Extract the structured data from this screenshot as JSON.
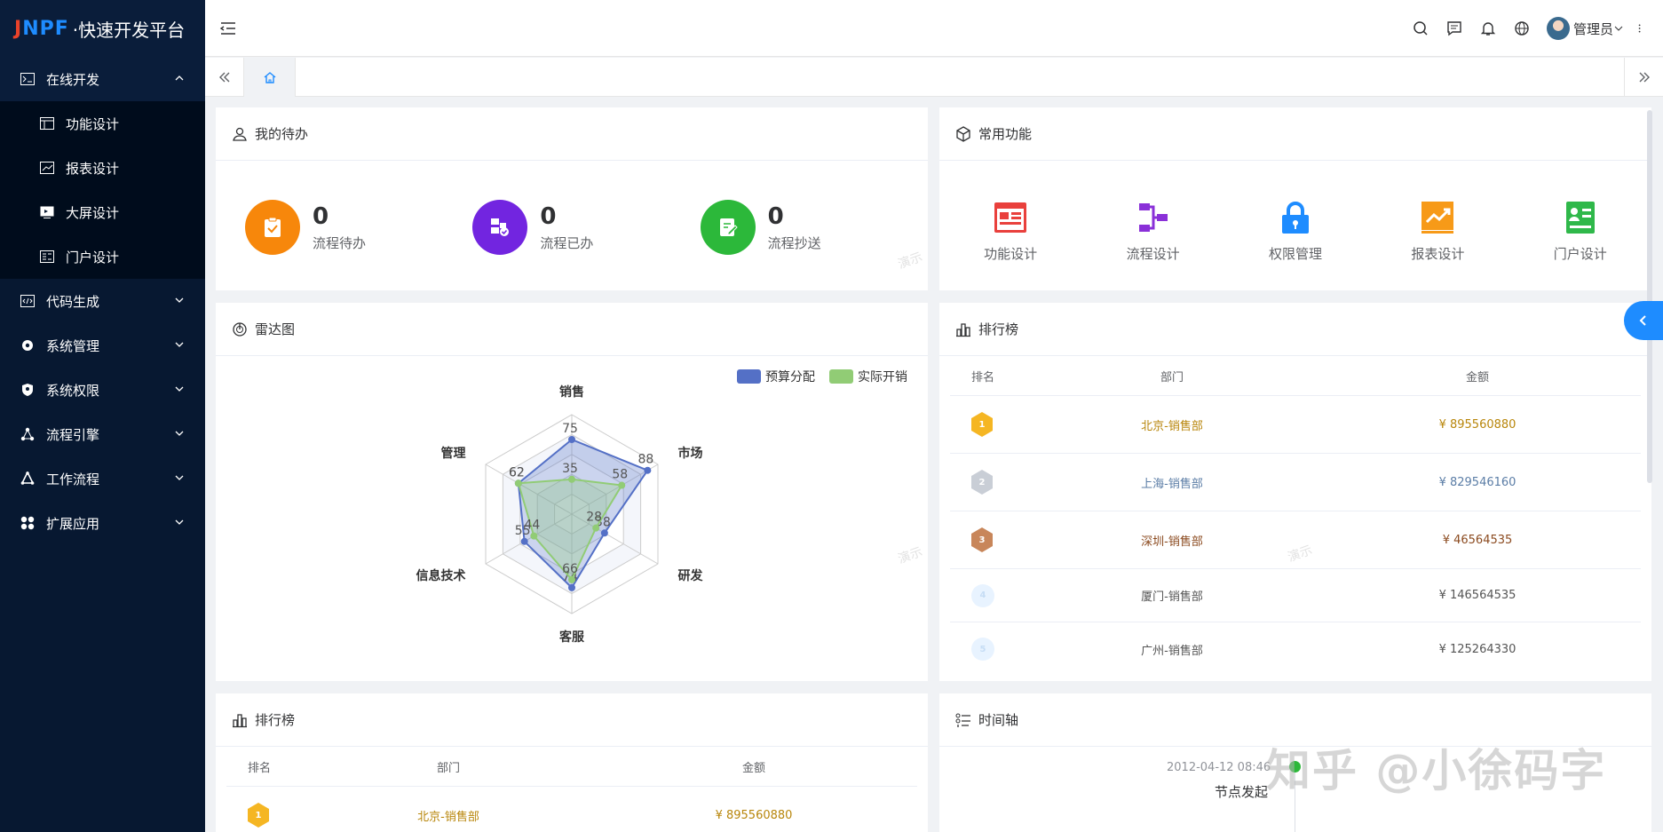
{
  "brand": {
    "logo_part1": "J",
    "logo_part2": "NPF",
    "platform": "·快速开发平台"
  },
  "sidebar": {
    "groups": [
      {
        "label": "在线开发",
        "icon": "terminal-icon",
        "open": true,
        "children": [
          {
            "label": "功能设计",
            "icon": "table-icon"
          },
          {
            "label": "报表设计",
            "icon": "chart-icon"
          },
          {
            "label": "大屏设计",
            "icon": "screen-icon"
          },
          {
            "label": "门户设计",
            "icon": "portal-icon"
          }
        ]
      },
      {
        "label": "代码生成",
        "icon": "code-icon"
      },
      {
        "label": "系统管理",
        "icon": "gear-icon"
      },
      {
        "label": "系统权限",
        "icon": "shield-icon"
      },
      {
        "label": "流程引擎",
        "icon": "flow-icon"
      },
      {
        "label": "工作流程",
        "icon": "workflow-icon"
      },
      {
        "label": "扩展应用",
        "icon": "apps-icon"
      }
    ]
  },
  "header": {
    "user_name": "管理员"
  },
  "todo": {
    "title": "我的待办",
    "items": [
      {
        "count": "0",
        "label": "流程待办",
        "color": "#f7870b"
      },
      {
        "count": "0",
        "label": "流程已办",
        "color": "#7225e0"
      },
      {
        "count": "0",
        "label": "流程抄送",
        "color": "#2cb83a"
      }
    ]
  },
  "functions": {
    "title": "常用功能",
    "items": [
      {
        "label": "功能设计",
        "color": "#e9403c"
      },
      {
        "label": "流程设计",
        "color": "#8a30d8"
      },
      {
        "label": "权限管理",
        "color": "#1e8cff"
      },
      {
        "label": "报表设计",
        "color": "#f79a18"
      },
      {
        "label": "门户设计",
        "color": "#2fb84a"
      }
    ]
  },
  "radar": {
    "title": "雷达图",
    "legend": [
      "预算分配",
      "实际开销"
    ]
  },
  "chart_data": {
    "type": "radar",
    "indicators": [
      "销售",
      "市场",
      "研发",
      "客服",
      "信息技术",
      "管理"
    ],
    "max": 100,
    "series": [
      {
        "name": "预算分配",
        "values": [
          75,
          88,
          38,
          74,
          55,
          62
        ],
        "color": "#5470c6"
      },
      {
        "name": "实际开销",
        "values": [
          35,
          58,
          28,
          66,
          44,
          62
        ],
        "color": "#91cc75"
      }
    ],
    "legend_position": "top-right"
  },
  "rank": {
    "title": "排行榜",
    "headers": [
      "排名",
      "部门",
      "金额"
    ],
    "rows": [
      {
        "rank": "1",
        "dept": "北京-销售部",
        "amount": "¥ 895560880",
        "color": "#b8860b",
        "badge": "#f5b623"
      },
      {
        "rank": "2",
        "dept": "上海-销售部",
        "amount": "¥ 829546160",
        "color": "#5b7da6",
        "badge": "#c9ced6"
      },
      {
        "rank": "3",
        "dept": "深圳-销售部",
        "amount": "¥ 46564535",
        "color": "#8b4a1f",
        "badge": "#c8865a"
      },
      {
        "rank": "4",
        "dept": "厦门-销售部",
        "amount": "¥ 146564535",
        "color": "#555555",
        "badge": ""
      },
      {
        "rank": "5",
        "dept": "广州-销售部",
        "amount": "¥ 125264330",
        "color": "#555555",
        "badge": ""
      }
    ]
  },
  "rank2": {
    "title": "排行榜",
    "headers": [
      "排名",
      "部门",
      "金额"
    ],
    "rows": [
      {
        "rank": "1",
        "dept": "北京-销售部",
        "amount": "¥ 895560880",
        "color": "#b8860b",
        "badge": "#f5b623"
      }
    ]
  },
  "timeline": {
    "title": "时间轴",
    "items": [
      {
        "time": "2012-04-12 08:46",
        "label": "节点发起"
      }
    ]
  },
  "watermark": "知乎 @小徐码字",
  "demo_mark": "演示"
}
